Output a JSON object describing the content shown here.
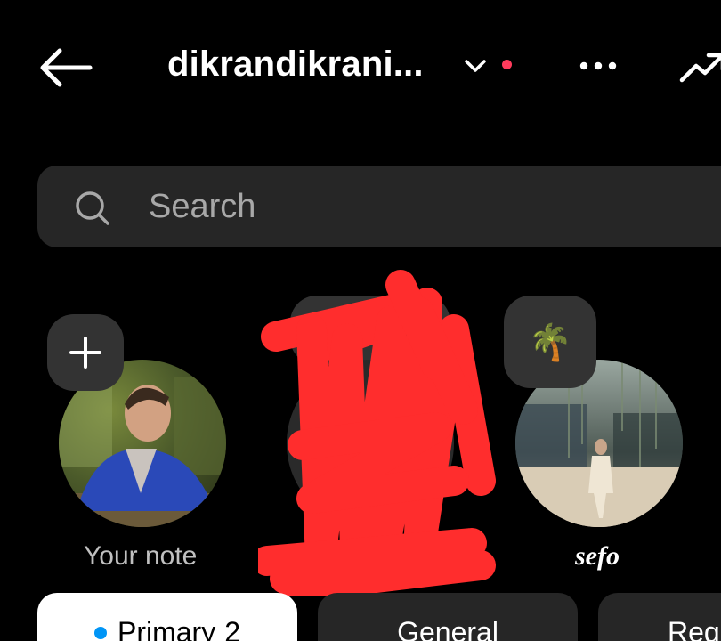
{
  "header": {
    "username": "dikrandikrani...",
    "unread_color": "#ff3b5c",
    "icons": {
      "back": "arrow-left-icon",
      "switch": "chevron-down-icon",
      "more": "more-horizontal-icon",
      "trend": "trend-up-icon"
    }
  },
  "search": {
    "placeholder": "Search",
    "icon": "search-icon"
  },
  "notes": [
    {
      "label": "Your note",
      "bubble_icon": "plus-icon"
    },
    {
      "label": "",
      "redacted": true
    },
    {
      "label": "sefo",
      "bubble_emoji": "🌴"
    }
  ],
  "tabs": [
    {
      "label": "Primary",
      "count": "2",
      "active": true,
      "dot_color": "#0095f6"
    },
    {
      "label": "General",
      "active": false
    },
    {
      "label": "Requ",
      "active": false
    }
  ]
}
